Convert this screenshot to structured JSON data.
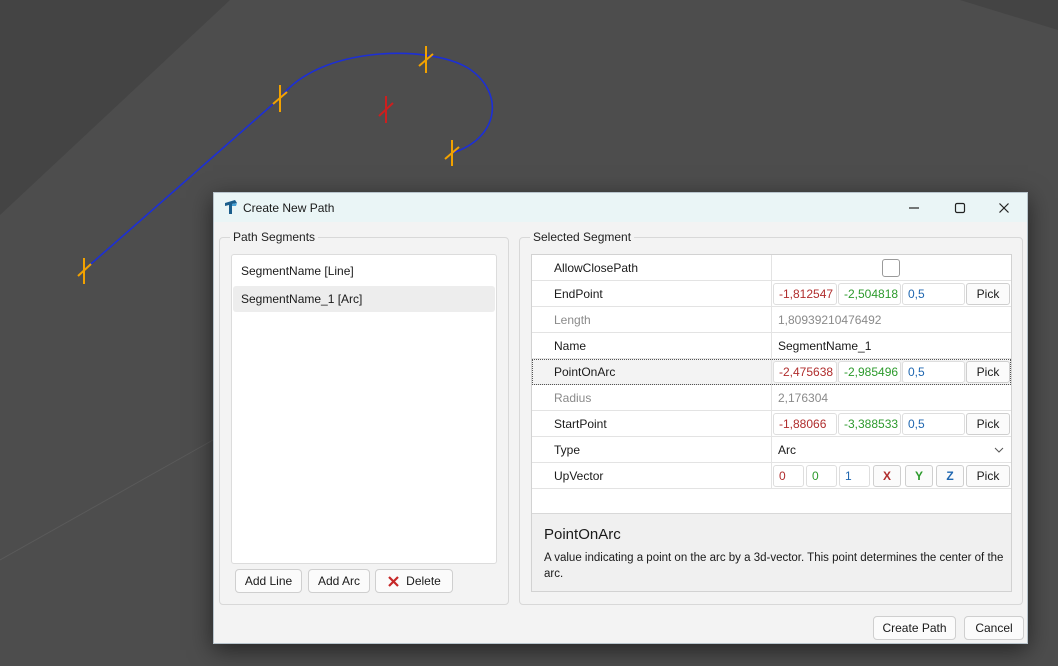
{
  "viewport": {
    "background_color": "#444444",
    "floor_color": "#4d4d4d",
    "path_color": "#1c2fd6",
    "marker_color": "#f2a200",
    "center_marker_color": "#cc1f1f"
  },
  "dialog": {
    "title": "Create New Path",
    "icon": "app-logo-icon",
    "minimize_icon": "minimize-icon",
    "maximize_icon": "maximize-icon",
    "close_icon": "close-icon",
    "left_group": {
      "title": "Path Segments",
      "segments": [
        {
          "label": "SegmentName [Line]",
          "selected": false
        },
        {
          "label": "SegmentName_1 [Arc]",
          "selected": true
        }
      ],
      "add_line_label": "Add Line",
      "add_arc_label": "Add Arc",
      "delete_label": "Delete",
      "delete_icon": "delete-x-icon"
    },
    "right_group": {
      "title": "Selected Segment",
      "pick_label": "Pick",
      "properties": {
        "allow_close_path": {
          "name": "AllowClosePath",
          "checked": false
        },
        "end_point": {
          "name": "EndPoint",
          "x": "-1,812547",
          "y": "-2,504818",
          "z": "0,5"
        },
        "length": {
          "name": "Length",
          "value": "1,80939210476492"
        },
        "name": {
          "name": "Name",
          "value": "SegmentName_1"
        },
        "point_on_arc": {
          "name": "PointOnArc",
          "x": "-2,475638",
          "y": "-2,985496",
          "z": "0,5"
        },
        "radius": {
          "name": "Radius",
          "value": "2,176304"
        },
        "start_point": {
          "name": "StartPoint",
          "x": "-1,88066",
          "y": "-3,388533",
          "z": "0,5"
        },
        "type": {
          "name": "Type",
          "value": "Arc"
        },
        "up_vector": {
          "name": "UpVector",
          "x": "0",
          "y": "0",
          "z": "1",
          "btn_x": "X",
          "btn_y": "Y",
          "btn_z": "Z"
        }
      },
      "description": {
        "title": "PointOnArc",
        "text": "A value indicating a point on the arc by a 3d-vector. This point determines the center of the arc."
      }
    },
    "footer": {
      "create_label": "Create Path",
      "cancel_label": "Cancel"
    }
  }
}
